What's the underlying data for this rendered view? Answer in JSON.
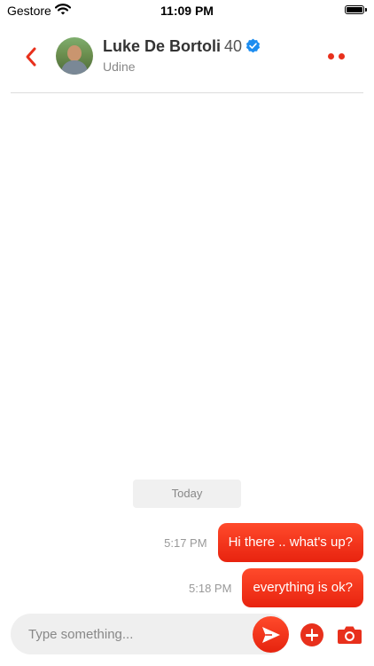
{
  "status_bar": {
    "carrier": "Gestore",
    "time": "11:09 PM",
    "icons": [
      "wifi-icon",
      "battery-icon"
    ]
  },
  "header": {
    "back_icon": "chevron-left-icon",
    "name": "Luke De Bortoli",
    "age": "40",
    "verified_icon": "verified-badge-icon",
    "city": "Udine",
    "menu_icon": "more-dots-icon"
  },
  "conversation": {
    "date_label": "Today",
    "messages": [
      {
        "time": "5:17 PM",
        "text": "Hi there .. what's up?",
        "outgoing": true
      },
      {
        "time": "5:18 PM",
        "text": "everything is ok?",
        "outgoing": true
      }
    ]
  },
  "composer": {
    "placeholder": "Type something...",
    "value": "",
    "send_icon": "send-icon",
    "add_icon": "plus-circle-icon",
    "camera_icon": "camera-icon"
  },
  "colors": {
    "accent": "#e8301c",
    "bubble_gradient_top": "#ff4a2b",
    "verified": "#1d8df0",
    "input_bg": "#efefef",
    "date_pill_bg": "#f0f0f0"
  }
}
